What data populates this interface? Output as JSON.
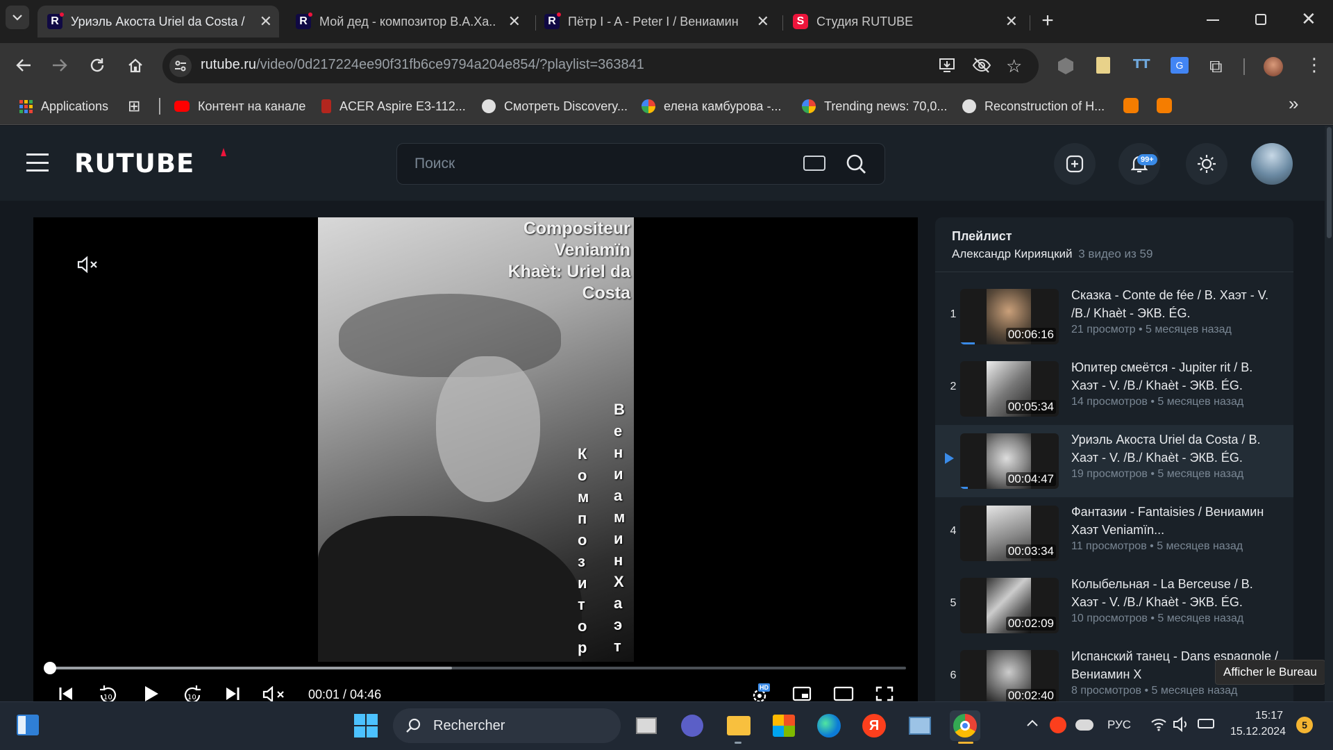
{
  "browser": {
    "tabs": [
      {
        "title": "Уриэль Акоста Uriel da Costa /",
        "icon": "rutube-favicon",
        "active": true
      },
      {
        "title": "Мой дед - композитор В.А.Ха...",
        "icon": "rutube-favicon",
        "active": false
      },
      {
        "title": "Пётр I - A - Peter I / Вениамин",
        "icon": "rutube-favicon",
        "active": false
      },
      {
        "title": "Студия RUTUBE",
        "icon": "rutube-studio-favicon",
        "active": false
      }
    ],
    "new_tab": "+",
    "url_host": "rutube.ru",
    "url_path": "/video/0d217224ee90f31fb6ce9794a204e854/?playlist=363841",
    "bookmarks": [
      {
        "label": "Applications",
        "icon": "apps-grid-icon"
      },
      {
        "label": "Контент на канале",
        "icon": "youtube-icon"
      },
      {
        "label": "ACER Aspire E3-112...",
        "icon": "bookmark-icon"
      },
      {
        "label": "Смотреть Discovery...",
        "icon": "globe-icon"
      },
      {
        "label": "елена камбурова -...",
        "icon": "google-icon"
      },
      {
        "label": "Trending news: 70,0...",
        "icon": "google-icon"
      },
      {
        "label": "Reconstruction of H...",
        "icon": "globe-icon"
      }
    ],
    "more_bookmarks": "»"
  },
  "rutube": {
    "logo": "RUTUBE",
    "search_placeholder": "Поиск",
    "notifications_badge": "99+"
  },
  "player": {
    "overlay_text_top": "Compositeur Veniamïn Khaèt: Uriel da Costa",
    "overlay_text_right": "Вениамин Хаэт",
    "overlay_text_left": "Композитор",
    "time_current": "00:01",
    "time_total": "04:46",
    "time_display": "00:01 / 04:46",
    "progress": 0.004,
    "buffered": 0.47,
    "hd_badge": "HD"
  },
  "playlist": {
    "heading": "Плейлист",
    "author": "Александр Кирияцкий",
    "count": "3 видео из 59",
    "items": [
      {
        "num": "1",
        "title": "Сказка - Conte de fée / В. Хаэт - V. /B./ Khaèt - ЭКВ. ÉG.",
        "duration": "00:06:16",
        "views": "21 просмотр",
        "age": "5 месяцев назад",
        "watched": 0.15
      },
      {
        "num": "2",
        "title": "Юпитер смеётся - Jupiter rit / В. Хаэт - V. /B./ Khaèt - ЭКВ. ÉG.",
        "duration": "00:05:34",
        "views": "14 просмотров",
        "age": "5 месяцев назад",
        "watched": 0
      },
      {
        "num": "",
        "title": "Уриэль Акоста Uriel da Costa / В. Хаэт - V. /B./ Khaèt - ЭКВ. ÉG.",
        "duration": "00:04:47",
        "views": "19 просмотров",
        "age": "5 месяцев назад",
        "watched": 0.08,
        "playing": true
      },
      {
        "num": "4",
        "title": "Фантазии - Fantaisies / Вениамин Хаэт Veniamïn...",
        "duration": "00:03:34",
        "views": "11 просмотров",
        "age": "5 месяцев назад",
        "watched": 0
      },
      {
        "num": "5",
        "title": "Колыбельная - La Berceuse / В. Хаэт - V. /B./ Khaèt - ЭКВ. ÉG.",
        "duration": "00:02:09",
        "views": "10 просмотров",
        "age": "5 месяцев назад",
        "watched": 0
      },
      {
        "num": "6",
        "title": "Испанский танец - Dans espagnole / Вениамин Х",
        "duration": "00:02:40",
        "views": "8 просмотров",
        "age": "5 месяцев назад",
        "watched": 0
      }
    ],
    "meta_sep": "•"
  },
  "tooltip": "Afficher le Bureau",
  "taskbar": {
    "search": "Rechercher",
    "lang": "РУС",
    "time": "15:17",
    "date": "15.12.2024",
    "notif_count": "5"
  }
}
